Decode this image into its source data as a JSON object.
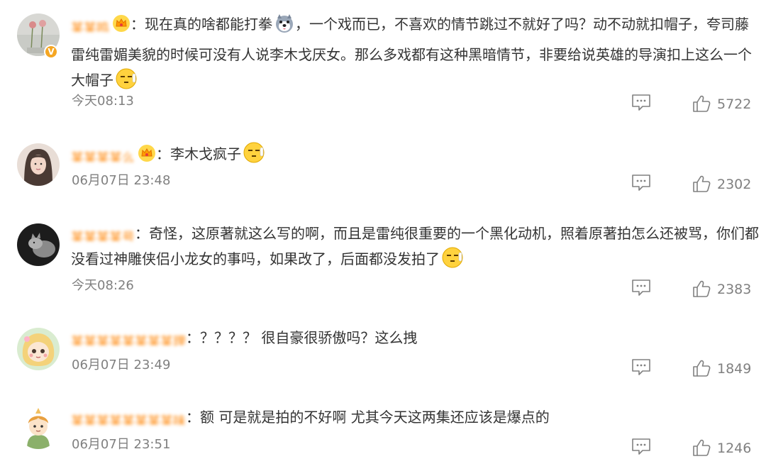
{
  "comments": [
    {
      "username": "某某鸣",
      "colon": "：",
      "text": "现在真的啥都能打拳",
      "text2": "，一个戏而已，不喜欢的情节跳过不就好了吗？动不动就扣帽子，夸司藤雷纯雷媚美貌的时候可没有人说李木戈厌女。那么多戏都有这种黑暗情节，非要给说英雄的导演扣上这么一个大帽子",
      "time": "今天08:13",
      "likes": "5722",
      "verified": true,
      "vip_crown": true
    },
    {
      "username": "某某某某么",
      "colon": "：",
      "text": "李木戈疯子",
      "time": "06月07日 23:48",
      "likes": "2302",
      "vip_crown": true
    },
    {
      "username": "某某某某号",
      "colon": "：",
      "text": "奇怪，这原著就这么写的啊，而且是雷纯很重要的一个黑化动机，照着原著拍怎么还被骂，你们都没看过神雕侠侣小龙女的事吗，如果改了，后面都没发拍了",
      "time": "今天08:26",
      "likes": "2383"
    },
    {
      "username": "某某某某某某某某理",
      "colon": "：",
      "text": "？？？？ 很自豪很骄傲吗？这么拽",
      "time": "06月07日 23:49",
      "likes": "1849"
    },
    {
      "username": "某某某某某某某某味",
      "colon": "：",
      "text": "额 可是就是拍的不好啊 尤其今天这两集还应该是爆点的",
      "time": "06月07日 23:51",
      "likes": "1246"
    }
  ],
  "icons": {
    "reply": "comment-reply-icon",
    "like": "thumbs-up-icon",
    "vip": "crown-badge-icon",
    "emoji_shy": "face-emoji",
    "emoji_dog": "husky-dog-emoji"
  },
  "colors": {
    "username": "#ff8200",
    "meta": "#808080",
    "text": "#333333",
    "verified": "#f5a623"
  }
}
